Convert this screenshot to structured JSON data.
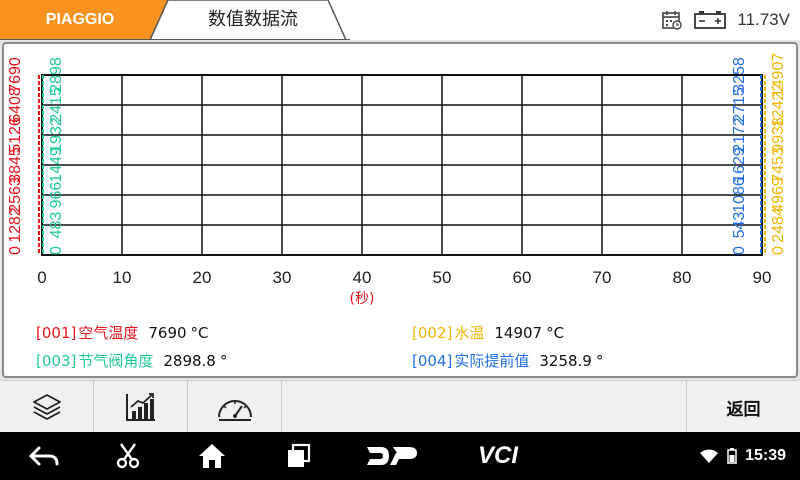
{
  "header": {
    "brand": "PIAGGIO",
    "title": "数值数据流",
    "voltage": "11.73V",
    "brand_color": "#f7931e"
  },
  "chart_data": {
    "type": "line",
    "xlabel": "(秒)",
    "xlim": [
      0,
      90
    ],
    "x_ticks": [
      "0",
      "10",
      "20",
      "30",
      "40",
      "50",
      "60",
      "70",
      "80",
      "90"
    ],
    "grid": true,
    "series": [
      {
        "name": "空气温度",
        "id": "[001]",
        "value": "7690",
        "unit": "°C",
        "color": "#e8141b",
        "axis": "left-outer",
        "tick_labels": [
          "0",
          "1282",
          "2563",
          "3845",
          "5126",
          "6408",
          "7690"
        ],
        "points": []
      },
      {
        "name": "节气阀角度",
        "id": "[003]",
        "value": "2898.8",
        "unit": "°",
        "color": "#1fc99a",
        "axis": "left-inner",
        "tick_labels": [
          "0",
          "483",
          "966",
          "1449",
          "1932",
          "2415",
          "2898"
        ],
        "points": []
      },
      {
        "name": "实际提前值",
        "id": "[004]",
        "value": "3258.9",
        "unit": "°",
        "color": "#1f6fe8",
        "axis": "right-inner",
        "tick_labels": [
          "0",
          "543",
          "1086",
          "1629",
          "2172",
          "2715",
          "3258"
        ],
        "points": []
      },
      {
        "name": "水温",
        "id": "[002]",
        "value": "14907",
        "unit": "°C",
        "color": "#f2b705",
        "axis": "right-outer",
        "tick_labels": [
          "0",
          "2484",
          "4969",
          "7453",
          "9938",
          "12422",
          "14907"
        ],
        "points": []
      }
    ]
  },
  "toolbar": {
    "layers_icon": "layers-icon",
    "graph_icon": "line-graph-icon",
    "gauge_icon": "gauge-icon",
    "back_label": "返回"
  },
  "navbar": {
    "time": "15:39",
    "vci_label": "VCI"
  }
}
